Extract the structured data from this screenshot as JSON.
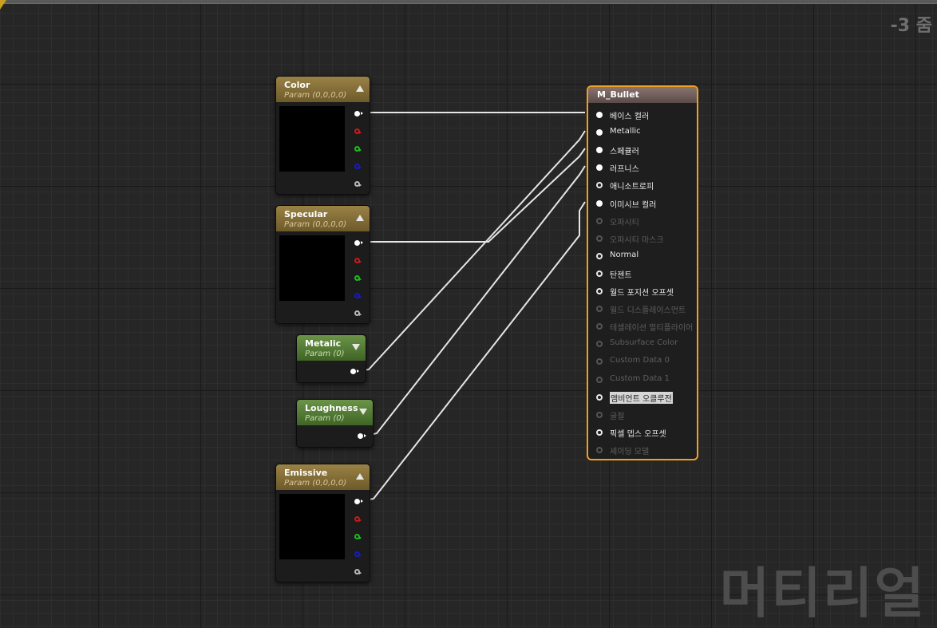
{
  "zoom_label": "-3 줌",
  "watermark": "머티리얼",
  "nodes": {
    "color": {
      "title": "Color",
      "subtitle": "Param (0,0,0,0)"
    },
    "specular": {
      "title": "Specular",
      "subtitle": "Param (0,0,0,0)"
    },
    "metalic": {
      "title": "Metalic",
      "subtitle": "Param (0)"
    },
    "loughness": {
      "title": "Loughness",
      "subtitle": "Param (0)"
    },
    "emissive": {
      "title": "Emissive",
      "subtitle": "Param (0,0,0,0)"
    }
  },
  "pin_colors": {
    "rgba": "#ffffff",
    "r": "#d01818",
    "g": "#18c018",
    "b": "#1818d0",
    "a": "#b8b8b8"
  },
  "material": {
    "title": "M_Bullet",
    "inputs": [
      {
        "label": "베이스 컬러",
        "state": "connected"
      },
      {
        "label": "Metallic",
        "state": "connected"
      },
      {
        "label": "스페큘러",
        "state": "connected"
      },
      {
        "label": "러프니스",
        "state": "connected"
      },
      {
        "label": "애니소트로피",
        "state": "enabled"
      },
      {
        "label": "이미시브 컬러",
        "state": "connected"
      },
      {
        "label": "오파시티",
        "state": "disabled"
      },
      {
        "label": "오파시티 마스크",
        "state": "disabled"
      },
      {
        "label": "Normal",
        "state": "enabled"
      },
      {
        "label": "탄젠트",
        "state": "enabled"
      },
      {
        "label": "월드 포지션 오프셋",
        "state": "enabled"
      },
      {
        "label": "월드 디스플레이스먼트",
        "state": "disabled"
      },
      {
        "label": "테셀레이션 멀티플라이어",
        "state": "disabled"
      },
      {
        "label": "Subsurface Color",
        "state": "disabled"
      },
      {
        "label": "Custom Data 0",
        "state": "disabled"
      },
      {
        "label": "Custom Data 1",
        "state": "disabled"
      },
      {
        "label": "앰비언트 오클루전",
        "state": "selected"
      },
      {
        "label": "굴절",
        "state": "disabled"
      },
      {
        "label": "픽셀 뎁스 오프셋",
        "state": "enabled"
      },
      {
        "label": "셰이딩 모델",
        "state": "disabled"
      }
    ]
  }
}
